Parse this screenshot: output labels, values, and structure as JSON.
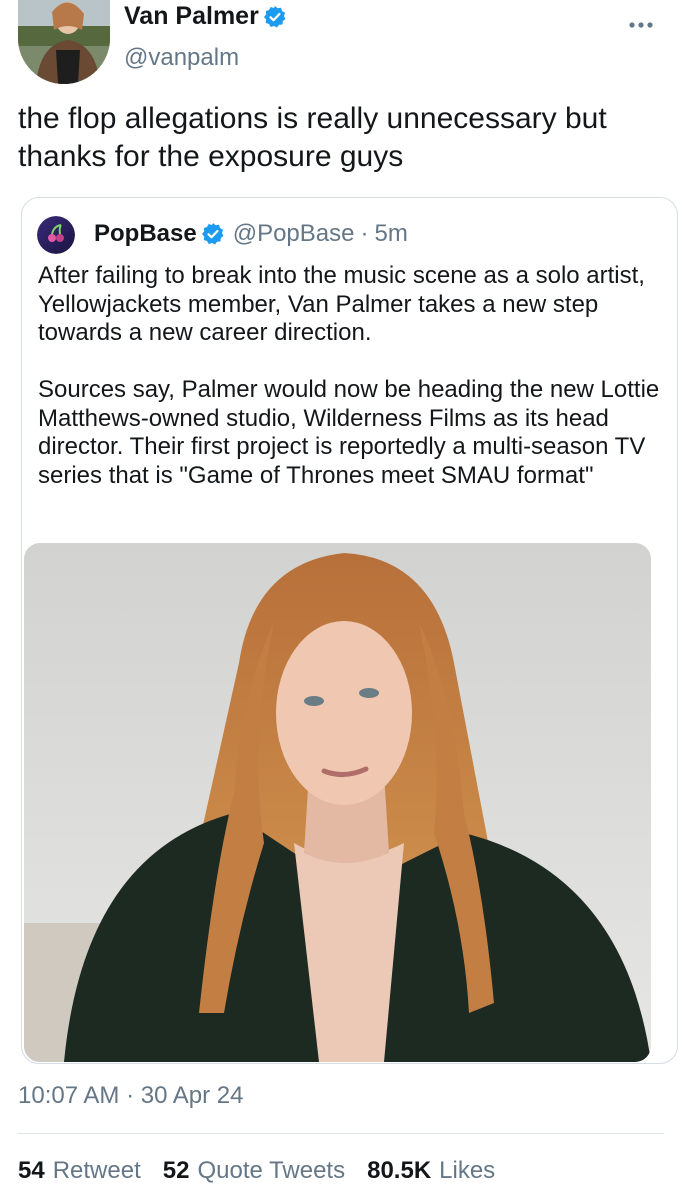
{
  "tweet": {
    "author_name": "Van Palmer",
    "author_handle": "@vanpalm",
    "text": "the flop allegations is really unnecessary but thanks for the exposure guys",
    "timestamp": "10:07 AM · 30 Apr 24",
    "verified": true
  },
  "quoted_tweet": {
    "author_name": "PopBase",
    "author_handle": "@PopBase",
    "separator": "·",
    "time_ago": "5m",
    "verified": true,
    "body": "After failing to break into the music scene as a solo artist, Yellowjackets member, Van Palmer takes a new step towards a new career direction.\n\nSources say, Palmer would now be heading the new Lottie Matthews-owned studio, Wilderness Films as its head director. Their first project is reportedly a multi-season TV series that is \"Game of Thrones meet SMAU format\"",
    "media": "portrait-photo"
  },
  "stats": {
    "retweets_count": "54",
    "retweets_label": "Retweet",
    "quotes_count": "52",
    "quotes_label": "Quote Tweets",
    "likes_count": "80.5K",
    "likes_label": "Likes"
  },
  "colors": {
    "text_primary": "#14171a",
    "text_secondary": "#657786",
    "verified_blue": "#1d9bf0",
    "border": "#d6dde3"
  },
  "icons": {
    "verified": "verified-badge-icon",
    "more": "more-options-icon"
  }
}
